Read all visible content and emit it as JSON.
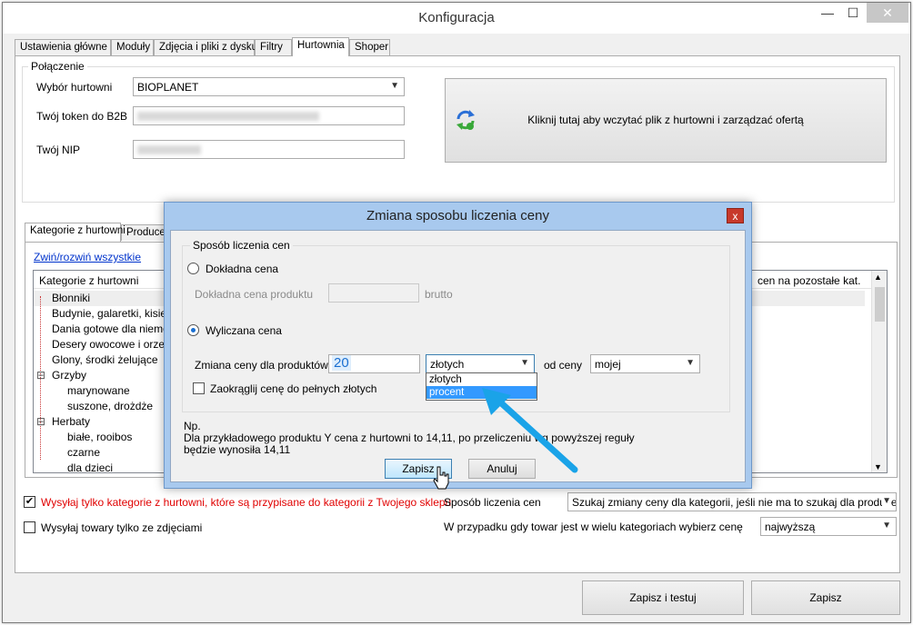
{
  "window": {
    "title": "Konfiguracja",
    "minimize": "—",
    "maximize": "☐",
    "close": "✕"
  },
  "tabs": [
    {
      "label": "Ustawienia główne"
    },
    {
      "label": "Moduły"
    },
    {
      "label": "Zdjęcia i pliki z dysku"
    },
    {
      "label": "Filtry"
    },
    {
      "label": "Hurtownia"
    },
    {
      "label": "Shoper"
    }
  ],
  "connection": {
    "legend": "Połączenie",
    "wholesaler_label": "Wybór hurtowni",
    "wholesaler_value": "BIOPLANET",
    "token_label": "Twój token do B2B",
    "nip_label": "Twój NIP",
    "load_button": "Kliknij tutaj aby wczytać plik z hurtowni i zarządzać ofertą",
    "load_icon": "refresh-icon"
  },
  "lower": {
    "subtabs": [
      {
        "label": "Kategorie z hurtowni"
      },
      {
        "label": "Producen"
      }
    ],
    "expand_link": "Zwiń/rozwiń wszystkie",
    "tree_header": "Kategorie z hurtowni",
    "right_header": "cen na pozostałe kat.",
    "tree": [
      "Błonniki",
      "Budynie, galaretki, kisiele, c",
      "Dania gotowe dla niemowla",
      "Desery owocowe i orzecho",
      "Glony, środki żelujące",
      "Grzyby",
      "marynowane",
      "suszone, drożdże",
      "Herbaty",
      "białe, rooibos",
      "czarne",
      "dla dzieci"
    ],
    "tree_expand": "⊟"
  },
  "options": {
    "send_only_label": "Wysyłaj tylko kategorie z hurtowni, które są przypisane do kategorii z Twojego sklepu",
    "send_only_checked": "✔",
    "with_photos_label": "Wysyłaj towary tylko ze zdjęciami",
    "price_method_label": "Sposób liczenia cen",
    "price_method_value": "Szukaj zmiany ceny dla kategorii, jeśli nie ma to szukaj dla producenta",
    "multi_cat_label": "W przypadku gdy towar jest w wielu kategoriach wybierz cenę",
    "multi_cat_value": "najwyższą"
  },
  "footer": {
    "save_test": "Zapisz i testuj",
    "save": "Zapisz"
  },
  "dialog": {
    "title": "Zmiana sposobu liczenia ceny",
    "close": "x",
    "group_legend": "Sposób liczenia cen",
    "exact_label": "Dokładna cena",
    "exact_product_label": "Dokładna cena produktu",
    "exact_suffix": "brutto",
    "calc_label": "Wyliczana cena",
    "change_label": "Zmiana ceny dla produktów o",
    "change_value": "20",
    "unit_value": "złotych",
    "unit_options": [
      "złotych",
      "procent"
    ],
    "from_label": "od ceny",
    "from_value": "mojej",
    "round_label": "Zaokrąglij cenę do pełnych złotych",
    "example_1": "Np.",
    "example_2": "Dla przykładowego produktu Y cena z hurtowni to 14,11, po przeliczeniu wg powyższej reguły",
    "example_3": "będzie wynosiła 14,11",
    "save": "Zapisz",
    "cancel": "Anuluj"
  }
}
